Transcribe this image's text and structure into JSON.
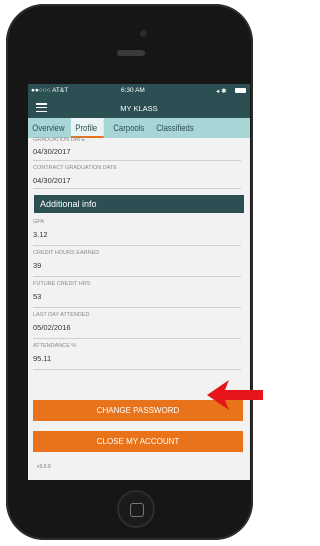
{
  "status_bar": {
    "carrier": "●●○○○ AT&T",
    "time": "6:30 AM",
    "icons": "◂ ✱"
  },
  "nav": {
    "title": "MY KLASS",
    "menu_icon": "hamburger-icon"
  },
  "tabs": [
    {
      "label": "Overview"
    },
    {
      "label": "Profile"
    },
    {
      "label": "Carpools"
    },
    {
      "label": "Classifieds"
    }
  ],
  "top_fields": [
    {
      "label": "GRADUATION DATE",
      "value": "04/30/2017"
    },
    {
      "label": "CONTRACT GRADUATION DATE",
      "value": "04/30/2017"
    }
  ],
  "section_title": "Additional info",
  "additional_fields": [
    {
      "label": "GPA",
      "value": "3.12"
    },
    {
      "label": "CREDIT HOURS EARNED",
      "value": "39"
    },
    {
      "label": "FUTURE CREDIT HRS",
      "value": "53"
    },
    {
      "label": "LAST DAY ATTENDED",
      "value": "05/02/2016"
    },
    {
      "label": "ATTENDANCE %",
      "value": "95.11"
    }
  ],
  "buttons": {
    "change_password": "CHANGE PASSWORD",
    "close_account": "CLOSE MY ACCOUNT"
  },
  "version": "v3.0.9",
  "colors": {
    "header": "#2b4f53",
    "tab_bar": "#a8d6d6",
    "accent": "#e8731a",
    "annotation_arrow": "#e8141c"
  }
}
